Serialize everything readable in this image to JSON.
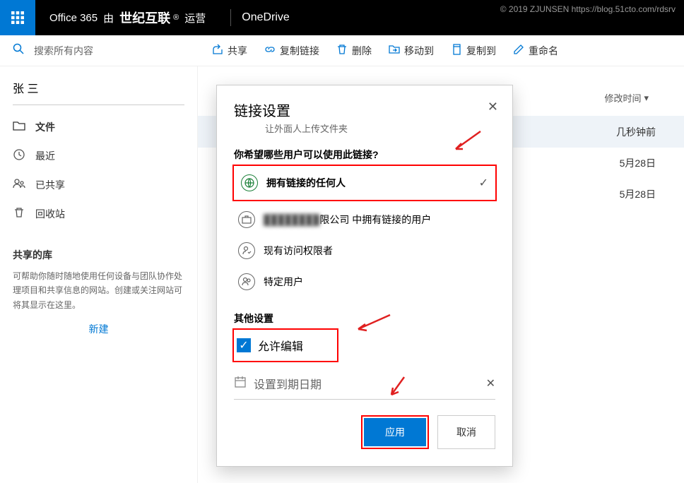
{
  "watermark": "© 2019 ZJUNSEN https://blog.51cto.com/rdsrv",
  "header": {
    "brand_prefix": "Office 365",
    "brand_by": "由",
    "brand_bold": "世纪互联",
    "brand_suffix": "运营",
    "app_name": "OneDrive"
  },
  "search": {
    "placeholder": "搜索所有内容"
  },
  "toolbar": {
    "share": "共享",
    "copylink": "复制链接",
    "delete": "删除",
    "moveto": "移动到",
    "copyto": "复制到",
    "rename": "重命名"
  },
  "sidebar": {
    "user": "张 三",
    "items": [
      "文件",
      "最近",
      "已共享",
      "回收站"
    ],
    "section_label": "共享的库",
    "section_desc": "可帮助你随时随地使用任何设备与团队协作处理项目和共享信息的网站。创建或关注网站可将其显示在这里。",
    "new": "新建"
  },
  "content": {
    "col_modified": "修改时间",
    "rows": [
      "几秒钟前",
      "5月28日",
      "5月28日"
    ]
  },
  "dialog": {
    "title": "链接设置",
    "subtitle": "让外面人上传文件夹",
    "question": "你希望哪些用户可以使用此链接?",
    "options": {
      "anyone": "拥有链接的任何人",
      "org_suffix": "限公司 中拥有链接的用户",
      "existing": "现有访问权限者",
      "specific": "特定用户"
    },
    "other_title": "其他设置",
    "allow_edit": "允许编辑",
    "set_date": "设置到期日期",
    "apply": "应用",
    "cancel": "取消"
  }
}
